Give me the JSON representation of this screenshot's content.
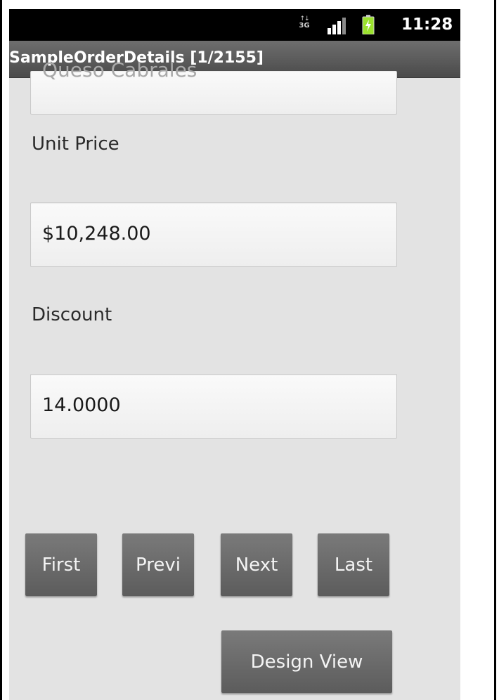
{
  "status_bar": {
    "network_label": "3G",
    "time": "11:28",
    "icons": [
      "network-3g-icon",
      "signal-icon",
      "battery-icon"
    ],
    "battery_color": "#9be22d"
  },
  "title_bar": {
    "title": "SampleOrderDetails [1/2155]"
  },
  "form": {
    "product_field_value": "Queso Cabrales",
    "unit_price_label": "Unit Price",
    "unit_price_value": "$10,248.00",
    "discount_label": "Discount",
    "discount_value": "14.0000"
  },
  "navigation": {
    "first_label": "First",
    "previous_label": "Previ",
    "next_label": "Next",
    "last_label": "Last",
    "design_view_label": "Design View"
  },
  "colors": {
    "background": "#e3e3e3",
    "button": "#666666",
    "title_bar": "#5a5a5a"
  }
}
